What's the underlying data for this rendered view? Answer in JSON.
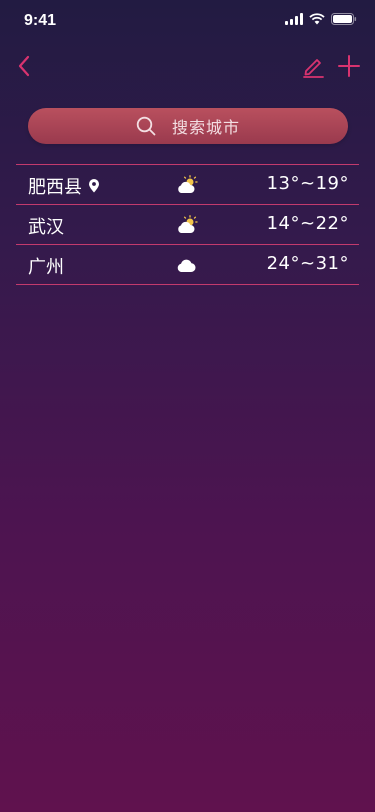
{
  "status_bar": {
    "time": "9:41"
  },
  "nav": {
    "back_icon": "chevron-left-icon",
    "edit_icon": "pencil-icon",
    "add_icon": "plus-icon"
  },
  "search": {
    "placeholder": "搜索城市",
    "icon": "search-icon"
  },
  "cities": [
    {
      "name": "肥西县",
      "located": true,
      "weather_icon": "partly-sunny-icon",
      "temp": "13°~19°"
    },
    {
      "name": "武汉",
      "located": false,
      "weather_icon": "partly-sunny-icon",
      "temp": "14°~22°"
    },
    {
      "name": "广州",
      "located": false,
      "weather_icon": "cloudy-icon",
      "temp": "24°~31°"
    }
  ],
  "colors": {
    "accent": "#d9336f",
    "search_bg": "#b0495a",
    "divider": "#c33a6d"
  }
}
